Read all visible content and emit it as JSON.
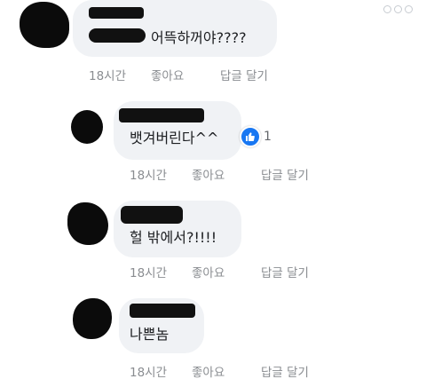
{
  "comments": [
    {
      "text": "어뜩하꺼야????",
      "time": "18시간",
      "like": "좋아요",
      "reply": "답글 달기"
    },
    {
      "text": "뱃겨버린다^^",
      "time": "18시간",
      "like": "좋아요",
      "reply": "답글 달기",
      "reaction_count": "1"
    },
    {
      "text": "헐 밖에서?!!!!",
      "time": "18시간",
      "like": "좋아요",
      "reply": "답글 달기"
    },
    {
      "text": "나쁜놈",
      "time": "18시간",
      "like": "좋아요",
      "reply": "답글 달기"
    }
  ],
  "icons": {
    "more": "more-options-icon",
    "reaction": "thumbs-up-icon"
  },
  "colors": {
    "bubble": "#f0f2f5",
    "meta": "#8a8d91",
    "like": "#1877f2"
  }
}
